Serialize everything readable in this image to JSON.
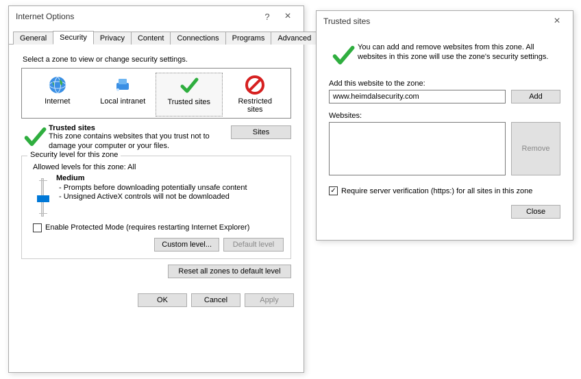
{
  "ioWindow": {
    "title": "Internet Options",
    "help": "?",
    "close": "×",
    "tabs": [
      "General",
      "Security",
      "Privacy",
      "Content",
      "Connections",
      "Programs",
      "Advanced"
    ],
    "activeTab": 1,
    "zoneInstr": "Select a zone to view or change security settings.",
    "zones": [
      {
        "label": "Internet"
      },
      {
        "label": "Local intranet"
      },
      {
        "label": "Trusted sites"
      },
      {
        "label": "Restricted sites"
      }
    ],
    "selectedZone": 2,
    "trustedTitle": "Trusted sites",
    "trustedDesc": "This zone contains websites that you trust not to damage your computer or your files.",
    "sitesBtn": "Sites",
    "group": {
      "title": "Security level for this zone",
      "allowed": "Allowed levels for this zone: All",
      "levelName": "Medium",
      "levelLine1": "- Prompts before downloading potentially unsafe content",
      "levelLine2": "- Unsigned ActiveX controls will not be downloaded",
      "protectedMode": "Enable Protected Mode (requires restarting Internet Explorer)",
      "customBtn": "Custom level...",
      "defaultBtn": "Default level"
    },
    "resetBtn": "Reset all zones to default level",
    "ok": "OK",
    "cancel": "Cancel",
    "apply": "Apply"
  },
  "tsWindow": {
    "title": "Trusted sites",
    "close": "×",
    "headText": "You can add and remove websites from this zone. All websites in this zone will use the zone's security settings.",
    "addLabel": "Add this website to the zone:",
    "addValue": "www.heimdalsecurity.com",
    "addBtn": "Add",
    "websitesLabel": "Websites:",
    "removeBtn": "Remove",
    "requireHttps": "Require server verification (https:) for all sites in this zone",
    "requireChecked": true,
    "closeBtn": "Close"
  }
}
